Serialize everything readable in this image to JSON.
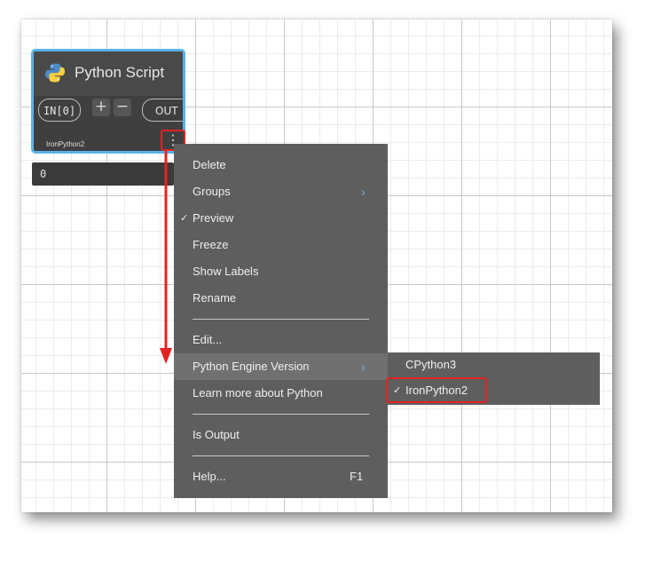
{
  "node": {
    "title": "Python Script",
    "input_port": "IN[0]",
    "add_port": "+",
    "remove_port": "−",
    "output_port": "OUT",
    "engine": "IronPython2",
    "more_menu": "⋮",
    "preview_value": "0",
    "icon": "python-icon",
    "border_color": "#59b3e8"
  },
  "context_menu": {
    "items": [
      {
        "label": "Delete",
        "checked": false,
        "submenu": false
      },
      {
        "label": "Groups",
        "checked": false,
        "submenu": true
      },
      {
        "label": "Preview",
        "checked": true,
        "submenu": false
      },
      {
        "label": "Freeze",
        "checked": false,
        "submenu": false
      },
      {
        "label": "Show Labels",
        "checked": false,
        "submenu": false
      },
      {
        "label": "Rename",
        "checked": false,
        "submenu": false
      },
      {
        "label": "Edit...",
        "checked": false,
        "submenu": false
      },
      {
        "label": "Python Engine Version",
        "checked": false,
        "submenu": true,
        "highlighted": true
      },
      {
        "label": "Learn more about Python",
        "checked": false,
        "submenu": false
      },
      {
        "label": "Is Output",
        "checked": false,
        "submenu": false
      },
      {
        "label": "Help...",
        "shortcut": "F1",
        "checked": false,
        "submenu": false
      }
    ],
    "check_mark": "✓",
    "submenu_arrow": "›"
  },
  "engine_submenu": {
    "items": [
      {
        "label": "CPython3",
        "checked": false
      },
      {
        "label": "IronPython2",
        "checked": true
      }
    ]
  },
  "colors": {
    "menu_bg": "#5e5e5e",
    "highlight_bg": "#707070",
    "annotation_red": "#e32222",
    "accent_blue": "#59b3e8"
  }
}
